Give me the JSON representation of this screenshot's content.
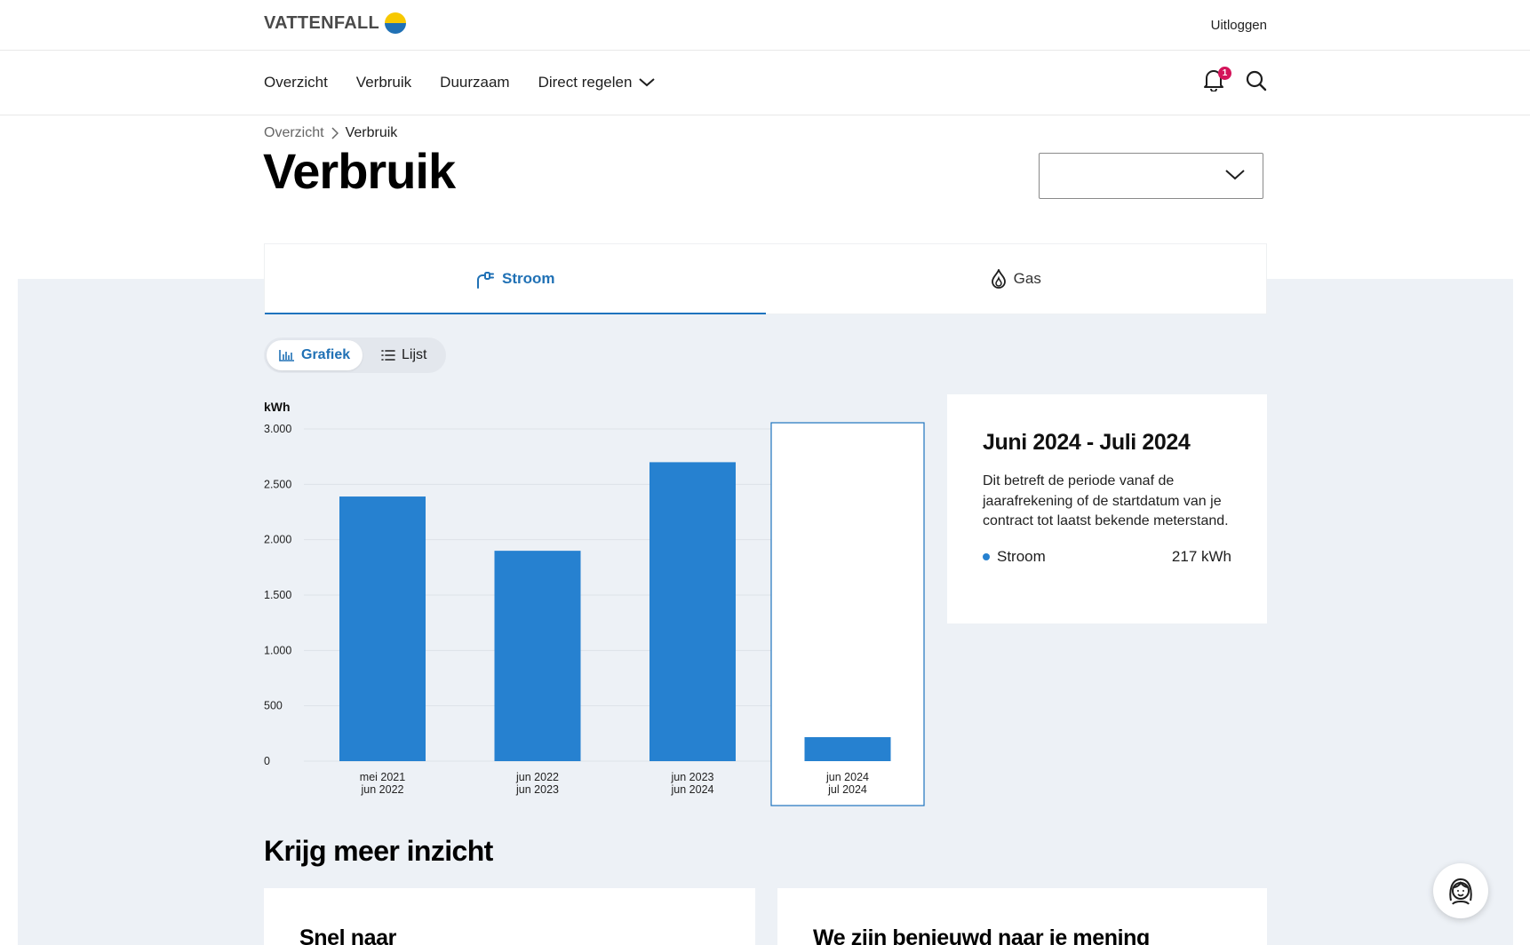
{
  "header": {
    "logo_text": "VATTENFALL",
    "logout_label": "Uitloggen"
  },
  "nav": {
    "items": [
      {
        "label": "Overzicht"
      },
      {
        "label": "Verbruik"
      },
      {
        "label": "Duurzaam"
      },
      {
        "label": "Direct regelen"
      }
    ],
    "notification_count": "1"
  },
  "breadcrumb": {
    "parent": "Overzicht",
    "current": "Verbruik"
  },
  "page_title": "Verbruik",
  "address_select": {
    "value": ""
  },
  "tabs": [
    {
      "label": "Stroom",
      "active": true
    },
    {
      "label": "Gas",
      "active": false
    }
  ],
  "view_toggle": {
    "chart_label": "Grafiek",
    "list_label": "Lijst",
    "active": "Grafiek"
  },
  "colors": {
    "accent": "#1e73be",
    "bar": "#2681d0",
    "band": "#edf1f6",
    "badge": "#d4145a"
  },
  "chart_data": {
    "type": "bar",
    "ylabel": "kWh",
    "ylim": [
      0,
      3000
    ],
    "yticks": [
      "3.000",
      "2.500",
      "2.000",
      "1.500",
      "1.000",
      "500",
      "0"
    ],
    "ytick_values": [
      3000,
      2500,
      2000,
      1500,
      1000,
      500,
      0
    ],
    "categories": [
      {
        "line1": "mei 2021",
        "line2": "jun 2022"
      },
      {
        "line1": "jun 2022",
        "line2": "jun 2023"
      },
      {
        "line1": "jun 2023",
        "line2": "jun 2024"
      },
      {
        "line1": "jun 2024",
        "line2": "jul 2024"
      }
    ],
    "values": [
      2390,
      1900,
      2700,
      217
    ],
    "selected_index": 3,
    "grid": true
  },
  "info_card": {
    "title": "Juni 2024 - Juli 2024",
    "text": "Dit betreft de periode vanaf de jaarafrekening of de startdatum van je contract tot laatst bekende meterstand.",
    "series_label": "Stroom",
    "series_value": "217 kWh"
  },
  "section": {
    "title": "Krijg meer inzicht",
    "cards": [
      {
        "title": "Snel naar"
      },
      {
        "title": "We zijn benieuwd naar je mening"
      }
    ]
  }
}
